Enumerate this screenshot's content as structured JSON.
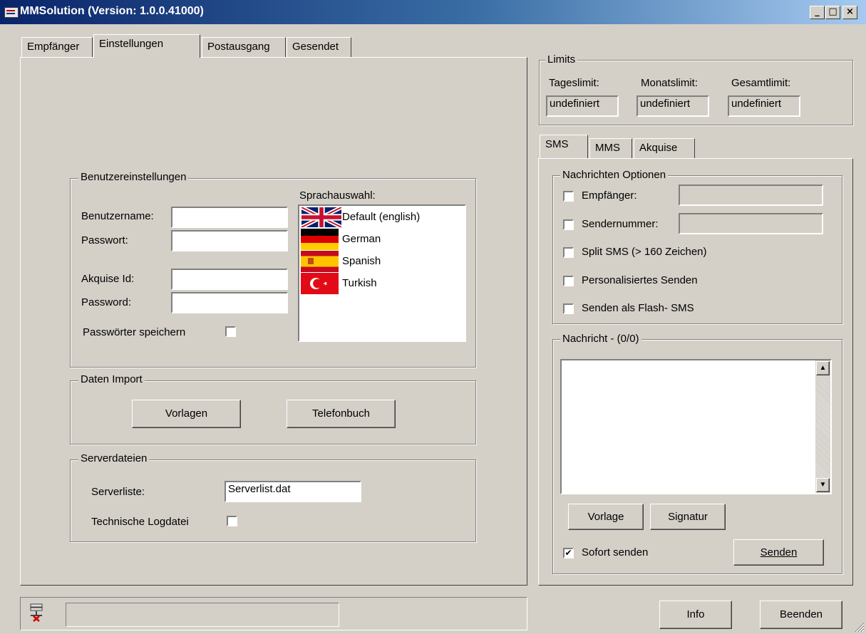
{
  "window": {
    "title": "MMSolution (Version: 1.0.0.41000)"
  },
  "tabs": [
    "Empfänger",
    "Einstellungen",
    "Postausgang",
    "Gesendet"
  ],
  "benutzer": {
    "title": "Benutzereinstellungen",
    "username_label": "Benutzername:",
    "password_label": "Passwort:",
    "akquise_label": "Akquise Id:",
    "password2_label": "Password:",
    "save_label": "Passwörter speichern",
    "lang_label": "Sprachauswahl:",
    "languages": [
      "Default (english)",
      "German",
      "Spanish",
      "Turkish"
    ]
  },
  "import": {
    "title": "Daten Import",
    "vorlagen": "Vorlagen",
    "telefonbuch": "Telefonbuch"
  },
  "server": {
    "title": "Serverdateien",
    "list_label": "Serverliste:",
    "list_value": "Serverlist.dat",
    "log_label": "Technische Logdatei"
  },
  "limits": {
    "title": "Limits",
    "items": [
      {
        "label": "Tageslimit:",
        "value": "undefiniert"
      },
      {
        "label": "Monatslimit:",
        "value": "undefiniert"
      },
      {
        "label": "Gesamtlimit:",
        "value": "undefiniert"
      }
    ]
  },
  "msgtabs": [
    "SMS",
    "MMS",
    "Akquise"
  ],
  "options": {
    "title": "Nachrichten Optionen",
    "empfaenger": "Empfänger:",
    "sendernummer": "Sendernummer:",
    "split": "Split SMS (> 160 Zeichen)",
    "personal": "Personalisiertes Senden",
    "flash": "Senden als Flash- SMS"
  },
  "message": {
    "title": "Nachricht - (0/0)",
    "vorlage": "Vorlage",
    "signatur": "Signatur",
    "sofort": "Sofort senden",
    "senden": "Senden"
  },
  "footer": {
    "info": "Info",
    "beenden": "Beenden"
  }
}
